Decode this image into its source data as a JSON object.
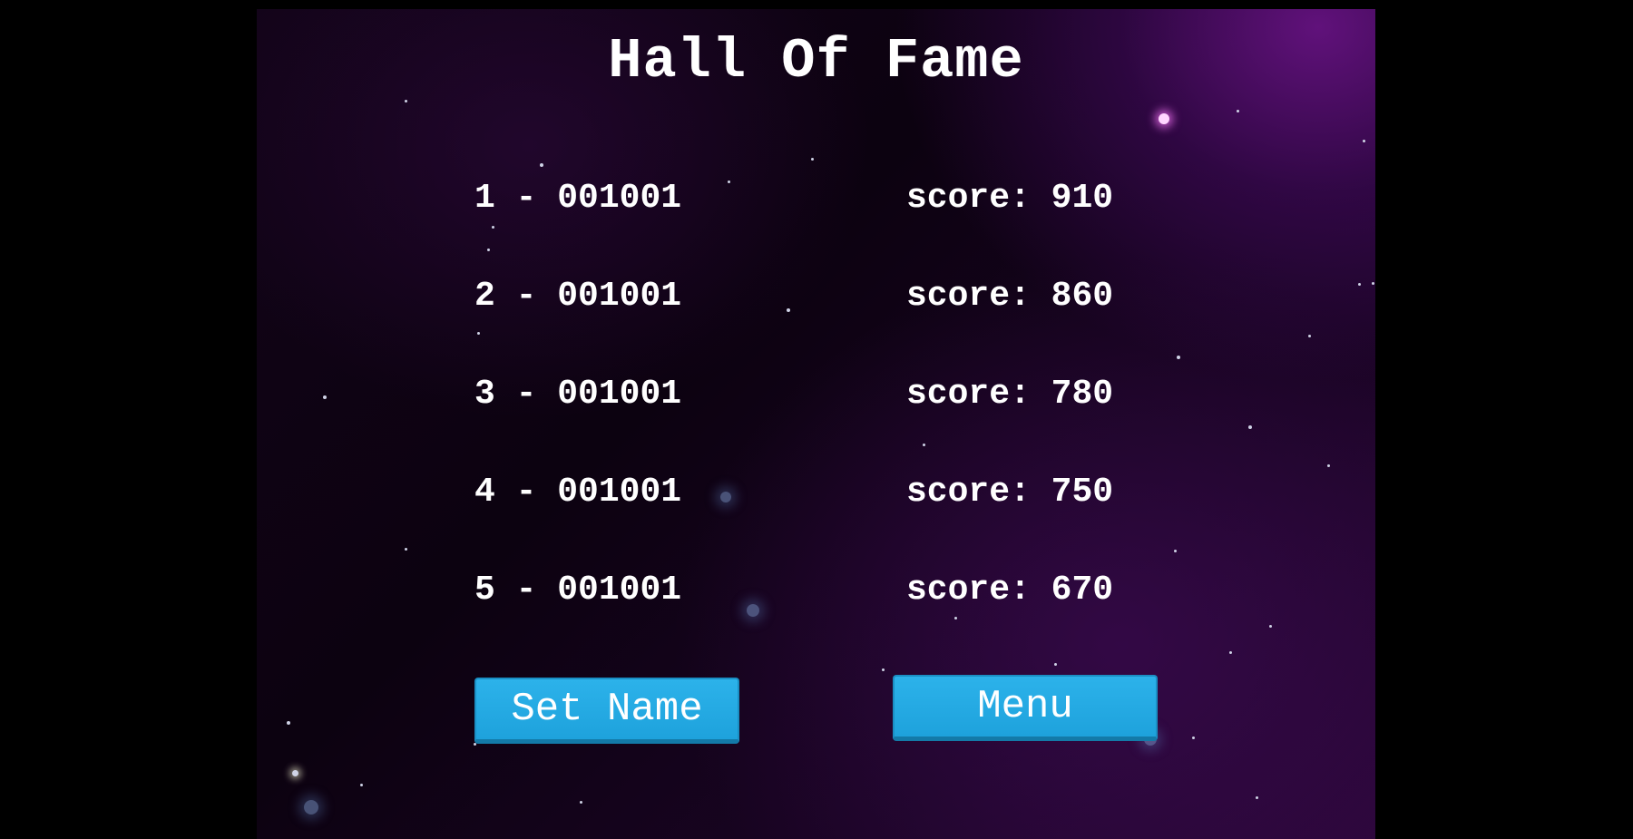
{
  "title": "Hall Of Fame",
  "leaderboard": [
    {
      "rank": "1",
      "name": "001001",
      "score_label": "score:",
      "score": "910"
    },
    {
      "rank": "2",
      "name": "001001",
      "score_label": "score:",
      "score": "860"
    },
    {
      "rank": "3",
      "name": "001001",
      "score_label": "score:",
      "score": "780"
    },
    {
      "rank": "4",
      "name": "001001",
      "score_label": "score:",
      "score": "750"
    },
    {
      "rank": "5",
      "name": "001001",
      "score_label": "score:",
      "score": "670"
    }
  ],
  "buttons": {
    "set_name": "Set Name",
    "menu": "Menu"
  },
  "colors": {
    "button": "#22a8e2",
    "text": "#ffffff",
    "background": "#12041a"
  }
}
